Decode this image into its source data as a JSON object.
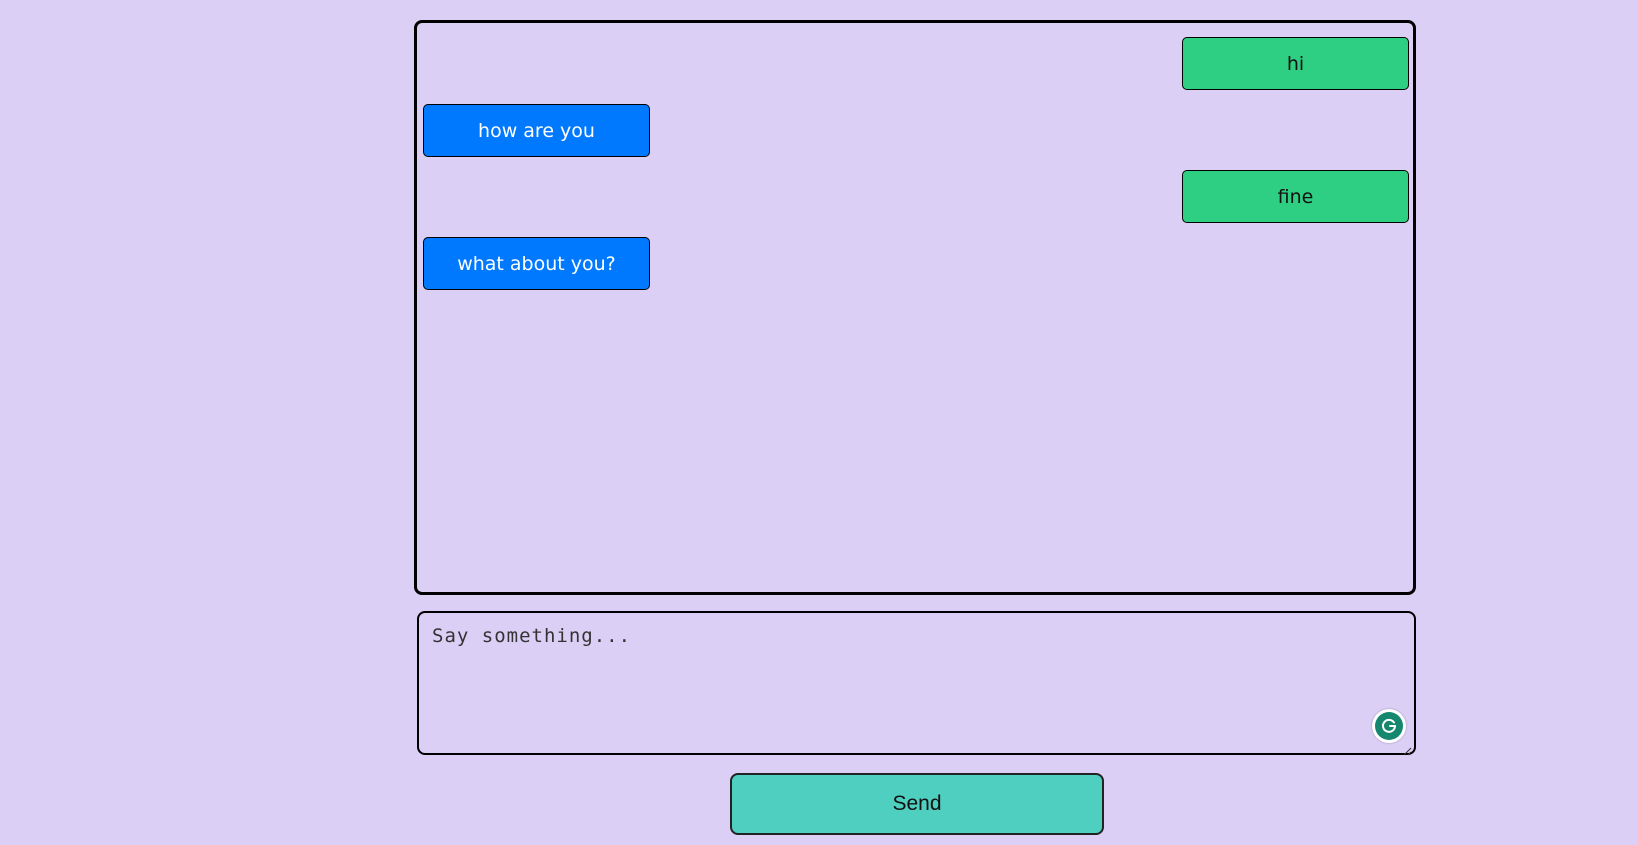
{
  "chat": {
    "messages": [
      {
        "text": "hi",
        "side": "outgoing"
      },
      {
        "text": "how are you",
        "side": "incoming"
      },
      {
        "text": "fine",
        "side": "outgoing"
      },
      {
        "text": "what about you?",
        "side": "incoming"
      }
    ]
  },
  "composer": {
    "placeholder": "Say something...",
    "value": ""
  },
  "actions": {
    "send_label": "Send"
  },
  "icons": {
    "grammarly": "grammarly-icon",
    "resize": "resize-handle-icon"
  },
  "colors": {
    "background": "#dccff5",
    "outgoing_bubble": "#2ecf83",
    "incoming_bubble": "#0079ff",
    "send_button": "#4ecfc0"
  }
}
